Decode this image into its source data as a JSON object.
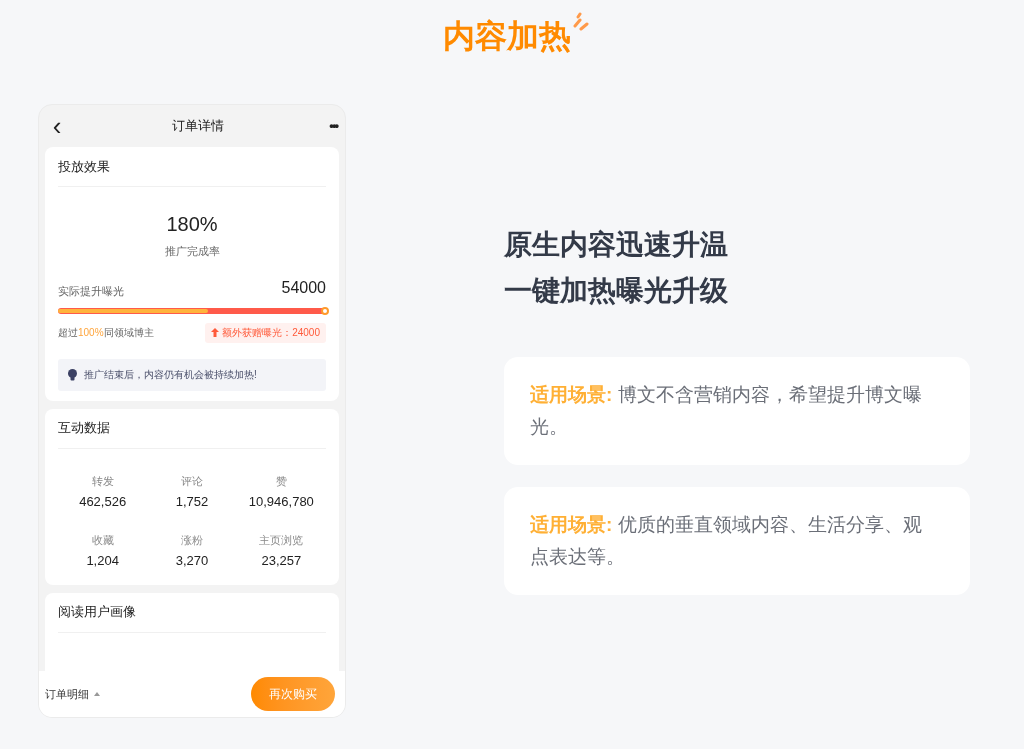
{
  "page_title": "内容加热",
  "phone": {
    "nav": {
      "back": "‹",
      "title": "订单详情",
      "more": "•••"
    },
    "effect": {
      "title": "投放效果",
      "rate": "180%",
      "rate_label": "推广完成率",
      "exposure_label": "实际提升曝光",
      "exposure_value": "54000",
      "level": 0.56,
      "beat_prefix": "超过",
      "beat_highlight": "100%",
      "beat_suffix": "同领域博主",
      "bonus": "额外获赠曝光：24000",
      "tip": "推广结束后，内容仍有机会被持续加热!"
    },
    "interaction": {
      "title": "互动数据",
      "stats": [
        {
          "label": "转发",
          "value": "462,526"
        },
        {
          "label": "评论",
          "value": "1,752"
        },
        {
          "label": "赞",
          "value": "10,946,780"
        },
        {
          "label": "收藏",
          "value": "1,204"
        },
        {
          "label": "涨粉",
          "value": "3,270"
        },
        {
          "label": "主页浏览",
          "value": "23,257"
        }
      ]
    },
    "portrait": {
      "title": "阅读用户画像"
    },
    "footer": {
      "detail": "订单明细",
      "buy": "再次购买"
    }
  },
  "headline": [
    "原生内容迅速升温",
    "一键加热曝光升级"
  ],
  "scenarios": [
    {
      "label": "适用场景:",
      "text": "博文不含营销内容，希望提升博文曝光。"
    },
    {
      "label": "适用场景:",
      "text": "优质的垂直领域内容、生活分享、观点表达等。"
    }
  ]
}
